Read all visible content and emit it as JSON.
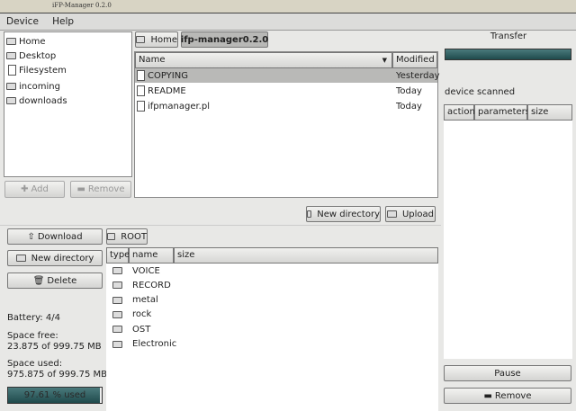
{
  "window": {
    "title": "iFP-Manager 0.2.0"
  },
  "menu": [
    "Device",
    "Help"
  ],
  "places": [
    {
      "label": "Home",
      "icon": "folder-icon"
    },
    {
      "label": "Desktop",
      "icon": "folder-icon"
    },
    {
      "label": "Filesystem",
      "icon": "drive-icon"
    },
    {
      "label": "incoming",
      "icon": "folder-icon"
    },
    {
      "label": "downloads",
      "icon": "folder-icon"
    }
  ],
  "places_buttons": {
    "add": "Add",
    "remove": "Remove"
  },
  "path": {
    "home": "Home",
    "current": "ifp-manager0.2.0"
  },
  "files": {
    "headers": {
      "name": "Name",
      "modified": "Modified"
    },
    "rows": [
      {
        "name": "COPYING",
        "modified": "Yesterday"
      },
      {
        "name": "README",
        "modified": "Today"
      },
      {
        "name": "ifpmanager.pl",
        "modified": "Today"
      }
    ]
  },
  "local_actions": {
    "new_directory": "New directory",
    "upload": "Upload"
  },
  "device_actions": {
    "download": "Download",
    "new_directory": "New directory",
    "delete": "Delete"
  },
  "device_info": {
    "battery": "Battery: 4/4",
    "space_free_label": "Space free:",
    "space_free": "23.875 of 999.75 MB",
    "space_used_label": "Space used:",
    "space_used": "975.875 of 999.75 MB",
    "usage_label": "97.61 % used",
    "usage_percent": 97.61
  },
  "device_path": {
    "root": "ROOT"
  },
  "device_list": {
    "headers": {
      "type": "type",
      "name": "name",
      "size": "size"
    },
    "rows": [
      "VOICE",
      "RECORD",
      "metal",
      "rock",
      "OST",
      "Electronic"
    ]
  },
  "transfer": {
    "title": "Transfer",
    "progress": 1.0,
    "status": "device scanned",
    "headers": {
      "action": "action",
      "parameters": "parameters",
      "size": "size"
    },
    "pause": "Pause",
    "remove": "Remove"
  }
}
